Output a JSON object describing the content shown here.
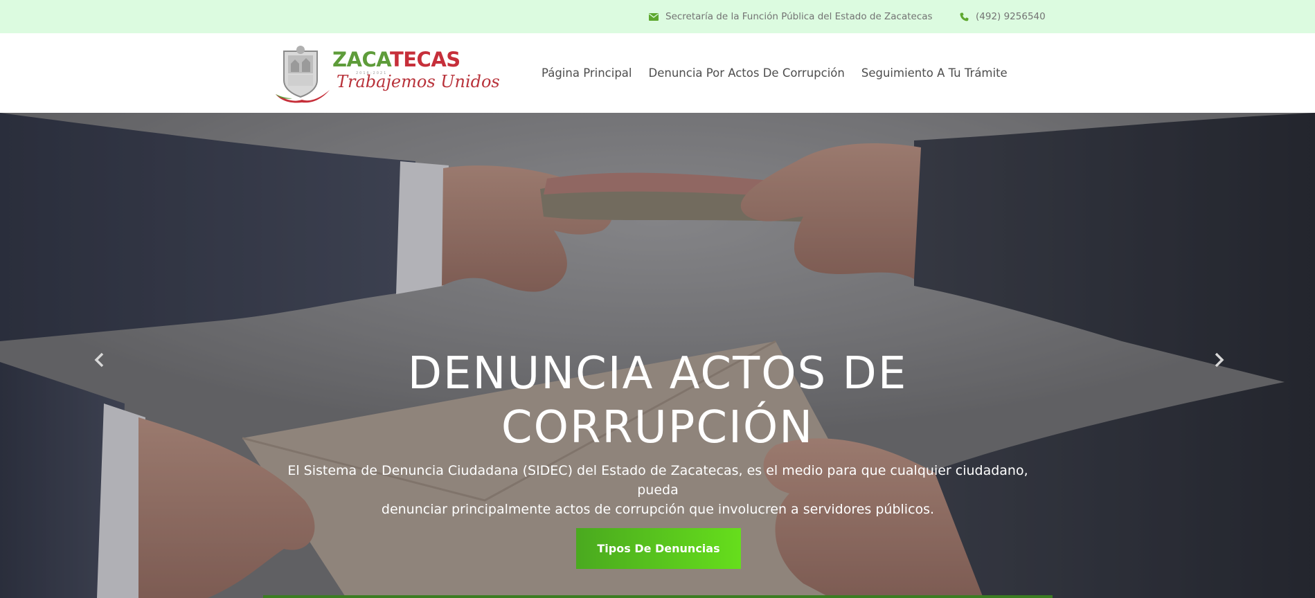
{
  "topbar": {
    "email_icon": "envelope-icon",
    "email_text": "Secretaría de la Función Pública del Estado de Zacatecas",
    "phone_icon": "phone-icon",
    "phone_text": "(492) 9256540",
    "accent_color": "#5ea82f",
    "background": "#dcfbe0"
  },
  "header": {
    "logo": {
      "wordmark_part1": "ZACA",
      "wordmark_part2": "TECAS",
      "slogan": "Trabajemos Unidos",
      "years": "2016-2021"
    },
    "nav": [
      {
        "label": "Página Principal"
      },
      {
        "label": "Denuncia Por Actos De Corrupción"
      },
      {
        "label": "Seguimiento A Tu Trámite"
      }
    ]
  },
  "hero": {
    "title_line1": "DENUNCIA ACTOS DE",
    "title_line2": "CORRUPCIÓN",
    "description_line1": "El Sistema de Denuncia Ciudadana (SIDEC) del Estado de Zacatecas, es el medio para que cualquier ciudadano, pueda",
    "description_line2": "denunciar principalmente actos de corrupción que involucren a servidores públicos.",
    "button_label": "Tipos De Denuncias",
    "button_color": "#4aa91f",
    "prev_icon": "chevron-left-icon",
    "next_icon": "chevron-right-icon"
  }
}
